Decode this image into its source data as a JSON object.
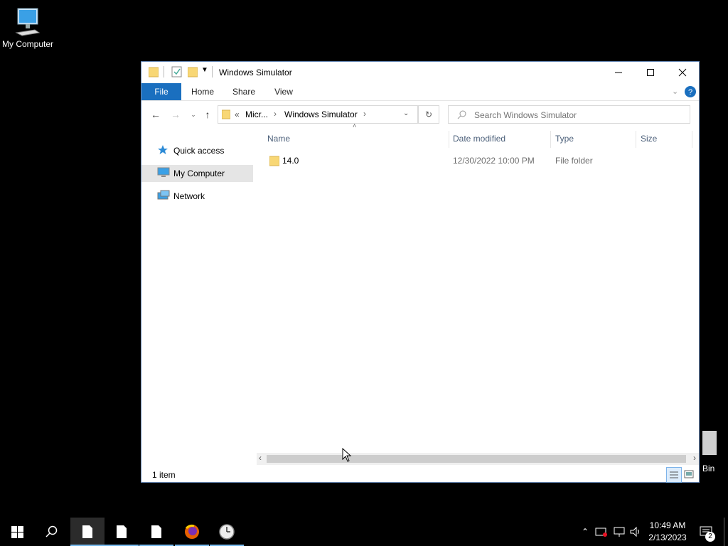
{
  "desktop": {
    "icons": [
      {
        "label": "My Computer"
      },
      {
        "label": "Bin"
      }
    ]
  },
  "window": {
    "title": "Windows Simulator",
    "ribbon_tabs": [
      {
        "label": "File"
      },
      {
        "label": "Home"
      },
      {
        "label": "Share"
      },
      {
        "label": "View"
      }
    ],
    "address": {
      "overflow": "«",
      "crumbs": [
        "Micr...",
        "Windows Simulator"
      ]
    },
    "search": {
      "placeholder": "Search Windows Simulator"
    },
    "nav": [
      {
        "label": "Quick access"
      },
      {
        "label": "My Computer"
      },
      {
        "label": "Network"
      }
    ],
    "columns": {
      "name": "Name",
      "date": "Date modified",
      "type": "Type",
      "size": "Size"
    },
    "files": [
      {
        "name": "14.0",
        "date": "12/30/2022 10:00 PM",
        "type": "File folder",
        "size": ""
      }
    ],
    "status": "1 item"
  },
  "taskbar": {
    "clock_time": "10:49 AM",
    "clock_date": "2/13/2023",
    "notification_count": "2"
  },
  "colors": {
    "accent": "#1a6fbf",
    "selection": "#e5e5e5",
    "folder": "#f8d775"
  }
}
